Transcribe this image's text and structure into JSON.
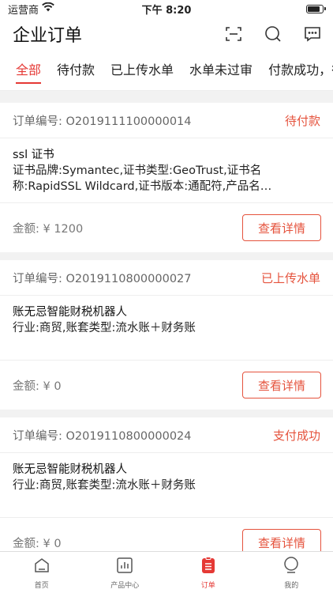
{
  "status_bar": {
    "carrier": "运营商",
    "time": "下午 8:20"
  },
  "nav": {
    "title": "企业订单"
  },
  "tabs": [
    "全部",
    "待付款",
    "已上传水单",
    "水单未过审",
    "付款成功，待"
  ],
  "orders": [
    {
      "order_no_label": "订单编号: O2019111100000014",
      "status": "待付款",
      "product_name": "ssl 证书",
      "description": "证书品牌:Symantec,证书类型:GeoTrust,证书名称:RapidSSL Wildcard,证书版本:通配符,产品名称:GEOTRUST",
      "amount": "金额: ¥ 1200",
      "button": "查看详情"
    },
    {
      "order_no_label": "订单编号: O2019110800000027",
      "status": "已上传水单",
      "product_name": "账无忌智能财税机器人",
      "description": "行业:商贸,账套类型:流水账＋财务账",
      "amount": "金额: ¥ 0",
      "button": "查看详情"
    },
    {
      "order_no_label": "订单编号: O2019110800000024",
      "status": "支付成功",
      "product_name": "账无忌智能财税机器人",
      "description": "行业:商贸,账套类型:流水账＋财务账",
      "amount": "金额: ¥ 0",
      "button": "查看详情"
    }
  ],
  "tabbar": [
    {
      "label": "首页",
      "icon": "home-icon"
    },
    {
      "label": "产品中心",
      "icon": "chart-icon"
    },
    {
      "label": "订单",
      "icon": "order-icon"
    },
    {
      "label": "我的",
      "icon": "profile-icon"
    }
  ],
  "colors": {
    "accent": "#e53935",
    "status": "#e5533d"
  }
}
